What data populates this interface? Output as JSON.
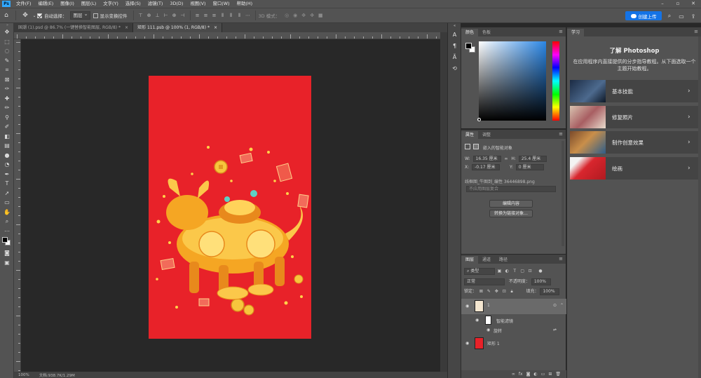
{
  "menubar": {
    "logo": "Ps",
    "items": [
      "文件(F)",
      "编辑(E)",
      "图像(I)",
      "图层(L)",
      "文字(Y)",
      "选择(S)",
      "滤镜(T)",
      "3D(D)",
      "视图(V)",
      "窗口(W)",
      "帮助(H)"
    ]
  },
  "options": {
    "auto_select_label": "自动选择：",
    "auto_select_value": "图层",
    "show_transform_label": "显示变换控件",
    "mode_3d_label": "3D 模式：",
    "cloud_button": "创建上传"
  },
  "tabs": [
    {
      "label": "国潮 (1).psd @ 86.7% (一键替换智能图层, RGB/8) *",
      "close": "×"
    },
    {
      "label": "矩形 111.psb @ 100% (1, RGB/8) *",
      "close": "×"
    }
  ],
  "status": {
    "zoom": "100%",
    "doc": "文档:938.7K/1.29M"
  },
  "color_panel": {
    "tabs": [
      "颜色",
      "色板"
    ]
  },
  "properties_panel": {
    "tabs": [
      "属性",
      "调整"
    ],
    "object_type": "嵌入的智能对象",
    "w_label": "W:",
    "w_value": "16.35 厘米",
    "h_label": "H:",
    "h_value": "25.4 厘米",
    "x_label": "X:",
    "x_value": "-0.17 厘米",
    "y_label": "Y:",
    "y_value": "0 厘米",
    "filename": "线框图_牛图到_编性 36446898.png",
    "layer_comp_placeholder": "不应用图层复合",
    "edit_contents_button": "编辑内容",
    "convert_button": "转换为链接对象..."
  },
  "layers_panel": {
    "tabs": [
      "图层",
      "通道",
      "路径"
    ],
    "filter_type": "类型",
    "blend_mode": "正常",
    "opacity_label": "不透明度：",
    "opacity_value": "100%",
    "lock_label": "锁定：",
    "fill_label": "填充：",
    "fill_value": "100%",
    "layers": [
      {
        "name": "1"
      },
      {
        "name": "智能滤镜"
      },
      {
        "name": "旋转"
      },
      {
        "name": "矩形 1"
      }
    ]
  },
  "learn_panel": {
    "tab": "学习",
    "title": "了解 Photoshop",
    "description": "在应用程序内直接提供的分步指导教程。从下面选取一个主题开始教程。",
    "cards": [
      {
        "label": "基本技能"
      },
      {
        "label": "修复照片"
      },
      {
        "label": "制作创意效果"
      },
      {
        "label": "绘画"
      }
    ]
  },
  "colors": {
    "artboard": "#e82229",
    "accent": "#1473e6",
    "ps_blue": "#31a8ff"
  }
}
